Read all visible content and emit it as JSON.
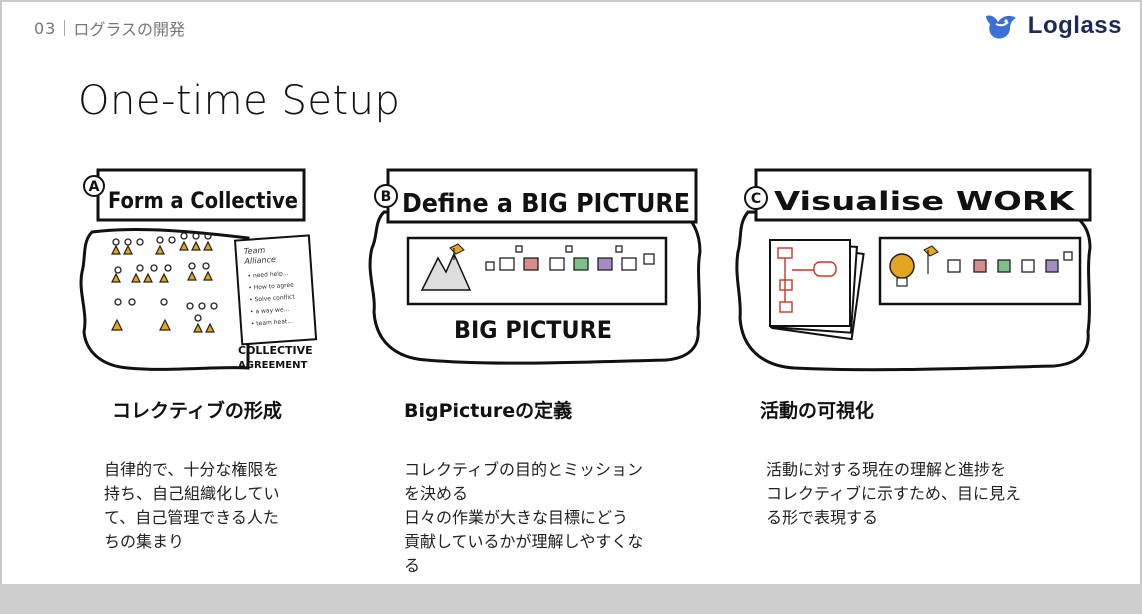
{
  "header": {
    "slide_number": "03",
    "section": "ログラスの開発"
  },
  "logo": {
    "text": "Loglass",
    "icon": "bird-logo-icon",
    "color": "#1f2a55"
  },
  "title": "One-time Setup",
  "cards": [
    {
      "illustration": {
        "letter": "A",
        "heading": "Form a Collective",
        "note_lines": [
          "Team",
          "Alliance",
          "• need help...",
          "• How to agree",
          "• Solve conflict",
          "• a way we...",
          "• team heat..."
        ],
        "footer": [
          "COLLECTIVE",
          "AGREEMENT"
        ]
      },
      "title": "コレクティブの形成",
      "desc": [
        "自律的で、十分な権限を",
        "持ち、自己組織化してい",
        "て、自己管理できる人た",
        "ちの集まり"
      ]
    },
    {
      "illustration": {
        "letter": "B",
        "heading": "Define a BIG PICTURE",
        "footer": [
          "BIG PICTURE"
        ]
      },
      "title": "BigPictureの定義",
      "desc": [
        "コレクティブの目的とミッション",
        "を決める",
        "日々の作業が大きな目標にどう",
        "貢献しているかが理解しやすくな",
        "る"
      ]
    },
    {
      "illustration": {
        "letter": "C",
        "heading": "Visualise WORK"
      },
      "title": "活動の可視化",
      "desc": [
        "活動に対する現在の理解と進捗を",
        "コレクティブに示すため、目に見え",
        "る形で表現する"
      ]
    }
  ],
  "colors": {
    "accent_orange": "#e2a623",
    "green": "#3aa35c",
    "red": "#c0392b",
    "purple": "#7b4fa0"
  }
}
